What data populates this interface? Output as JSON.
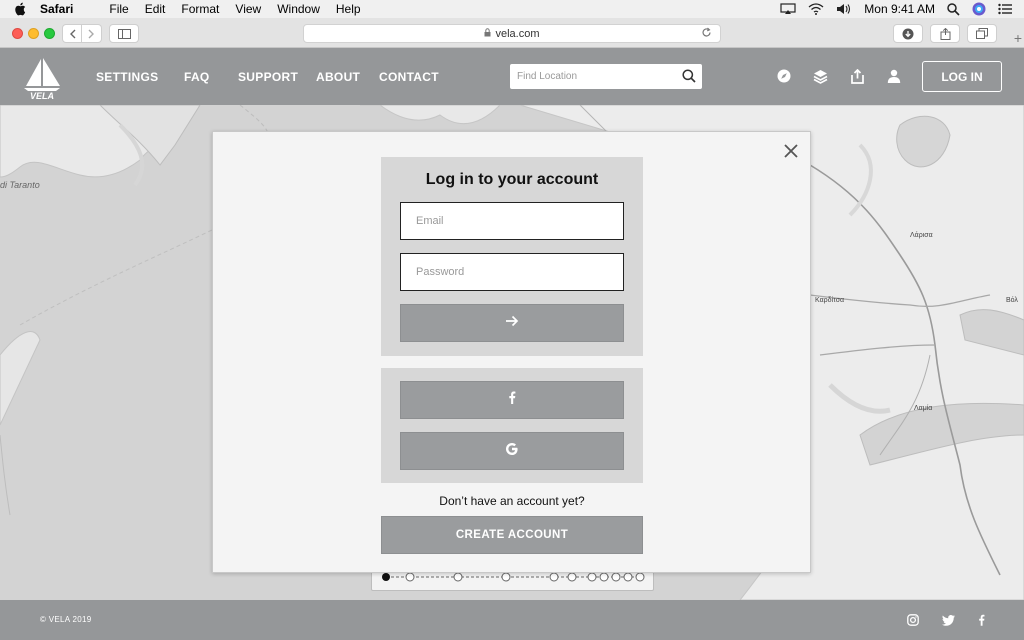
{
  "menubar": {
    "app_name": "Safari",
    "items": [
      "File",
      "Edit",
      "Format",
      "View",
      "Window",
      "Help"
    ],
    "clock": "Mon 9:41 AM"
  },
  "browser": {
    "url": "vela.com"
  },
  "site": {
    "logo_text": "VELA",
    "nav": [
      "SETTINGS",
      "FAQ",
      "SUPPORT",
      "ABOUT",
      "CONTACT"
    ],
    "search_placeholder": "Find Location",
    "login_label": "LOG IN",
    "header_icons": [
      "compass-icon",
      "layers-icon",
      "share-icon",
      "user-icon"
    ]
  },
  "map": {
    "labels": [
      "di Taranto"
    ],
    "cities": [
      "Λάρισα",
      "Καρδίτσα",
      "Λαμία",
      "Βόλ"
    ]
  },
  "modal": {
    "title": "Log in to your account",
    "email_placeholder": "Email",
    "password_placeholder": "Password",
    "submit_icon": "arrow-right-icon",
    "social": [
      "facebook-icon",
      "google-icon"
    ],
    "no_account_text": "Don’t have an account yet?",
    "create_label": "CREATE ACCOUNT"
  },
  "footer": {
    "copyright": "© VELA 2019",
    "social_icons": [
      "instagram-icon",
      "twitter-icon",
      "facebook-icon"
    ]
  },
  "colors": {
    "header_gray": "#959799",
    "button_gray": "#9a9c9e",
    "panel_gray": "#d7d7d7",
    "modal_bg": "#f4f4f4"
  }
}
